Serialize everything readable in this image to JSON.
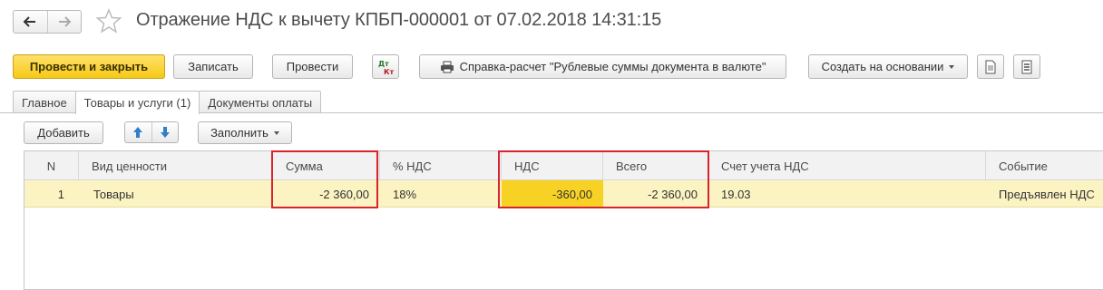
{
  "document": {
    "title": "Отражение НДС к вычету КПБП-000001 от 07.02.2018 14:31:15"
  },
  "toolbar": {
    "post_and_close": "Провести и закрыть",
    "save": "Записать",
    "post": "Провести",
    "report": "Справка-расчет \"Рублевые суммы документа в валюте\"",
    "create_based_on": "Создать на основании"
  },
  "tabs": [
    {
      "label": "Главное",
      "active": false
    },
    {
      "label": "Товары и услуги (1)",
      "active": true
    },
    {
      "label": "Документы оплаты",
      "active": false
    }
  ],
  "table_toolbar": {
    "add": "Добавить",
    "fill": "Заполнить"
  },
  "table": {
    "columns": [
      "N",
      "Вид ценности",
      "Сумма",
      "% НДС",
      "НДС",
      "Всего",
      "Счет учета НДС",
      "Событие"
    ],
    "rows": [
      {
        "n": "1",
        "type": "Товары",
        "sum": "-2 360,00",
        "vat_rate": "18%",
        "vat": "-360,00",
        "total": "-2 360,00",
        "account": "19.03",
        "event": "Предъявлен НДС"
      }
    ]
  },
  "colors": {
    "accent_yellow": "#f6c916",
    "row_selected": "#fbf3c2",
    "cell_current": "#f7d224",
    "highlight_box": "#d9232e"
  },
  "icons": {
    "back": "arrow-left-icon",
    "forward": "arrow-right-icon",
    "favorite": "star-icon",
    "dt_kt": "dt-kt-icon",
    "print": "printer-icon",
    "document": "document-icon",
    "list": "list-icon",
    "move_up": "arrow-up-icon",
    "move_down": "arrow-down-icon"
  }
}
